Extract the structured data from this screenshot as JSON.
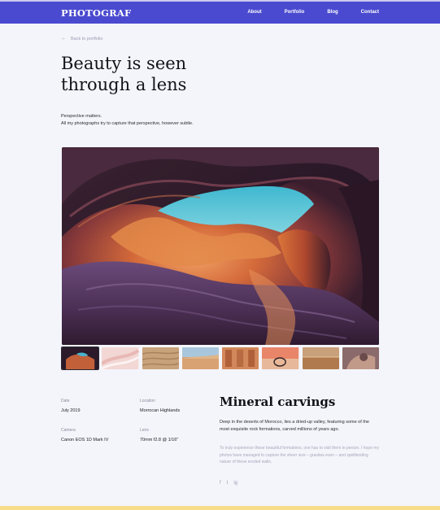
{
  "header": {
    "logo": "PHOTOGRAF",
    "nav": [
      "About",
      "Portfolio",
      "Blog",
      "Contact"
    ]
  },
  "back_link": "Back to portfolio",
  "page_title": "Beauty is seen through a lens",
  "intro": {
    "line1": "Perspective matters.",
    "line2": "All my photographs try to capture that perspective, however subtle."
  },
  "details": {
    "date_label": "Date",
    "date_value": "July 2019",
    "location_label": "Location",
    "location_value": "Morrocan Highlands",
    "camera_label": "Camera",
    "camera_value": "Canon EOS 1D Mark IV",
    "lens_label": "Lens",
    "lens_value": "70mm f2.8 @ 1/16\""
  },
  "section": {
    "title": "Mineral carvings",
    "description": "Deep in the deserts of Morocco, lies a dried-up valley, featuring some of the most exquisite rock formations, carved millions of years ago.",
    "description2": "To truly experience these beautiful formations, one has to visit them in person. I hope my photos have managed to capture the sheer size – gravitas even – and spellbinding nature of these eroded walls."
  },
  "social": [
    "f",
    "t",
    "ig"
  ],
  "colors": {
    "topbar": "#4a4ad0",
    "background": "#f4f5fb",
    "footer_bar": "#f7dc8a"
  }
}
